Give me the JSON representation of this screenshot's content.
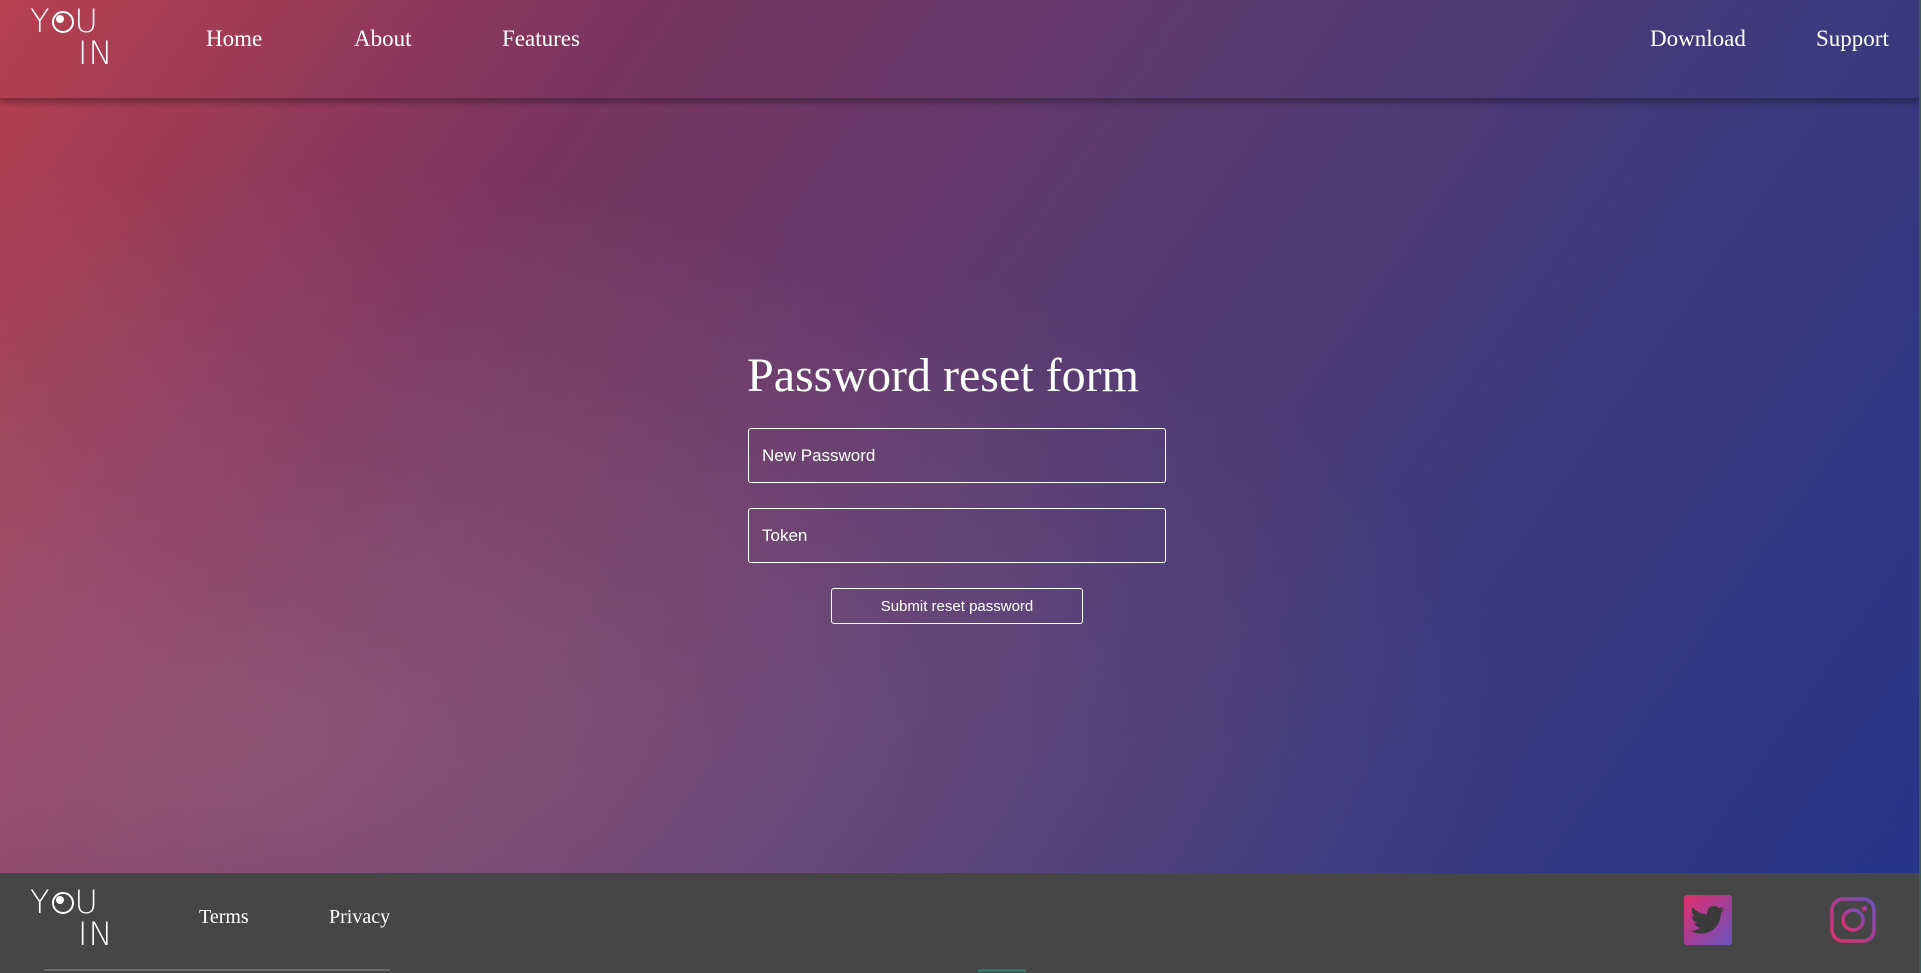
{
  "header": {
    "logo": {
      "line1_before": "Y",
      "line1_after": "U",
      "line2": "IN"
    },
    "nav_left": [
      "Home",
      "About",
      "Features"
    ],
    "nav_right": [
      "Download",
      "Support"
    ]
  },
  "form": {
    "title": "Password reset form",
    "new_password_placeholder": "New Password",
    "token_placeholder": "Token",
    "submit_label": "Submit reset password"
  },
  "footer": {
    "logo": {
      "line1_before": "Y",
      "line1_after": "U",
      "line2": "IN"
    },
    "links": [
      "Terms",
      "Privacy"
    ],
    "social_icons": [
      "twitter-icon",
      "instagram-icon"
    ]
  },
  "colors": {
    "gradient_start": "#b8404f",
    "gradient_mid": "#5a3a70",
    "gradient_end": "#25358a",
    "footer_bg": "#464646",
    "text": "#ffffff"
  }
}
